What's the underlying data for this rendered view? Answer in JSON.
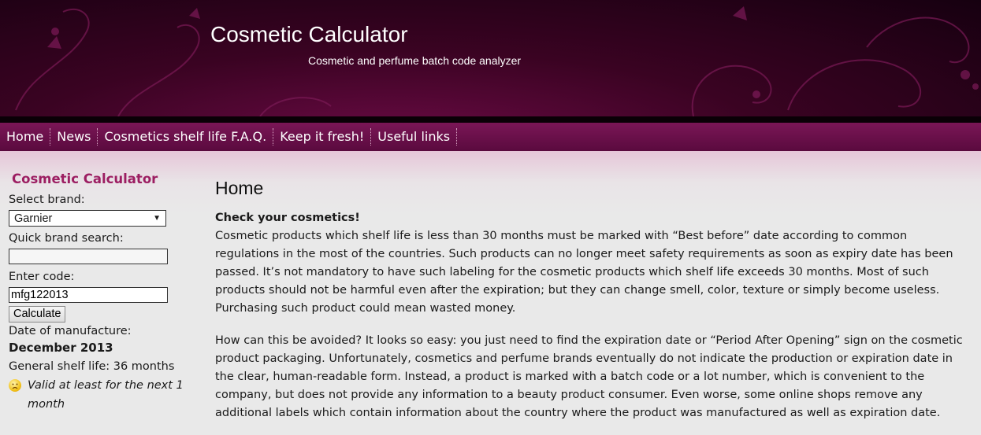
{
  "header": {
    "title": "Cosmetic Calculator",
    "subtitle": "Cosmetic and perfume batch code analyzer"
  },
  "nav": {
    "items": [
      "Home",
      "News",
      "Cosmetics shelf life F.A.Q.",
      "Keep it fresh!",
      "Useful links"
    ]
  },
  "sidebar": {
    "title": "Cosmetic Calculator",
    "brand_label": "Select brand:",
    "brand_value": "Garnier",
    "search_label": "Quick brand search:",
    "search_value": "",
    "code_label": "Enter code:",
    "code_value": "mfg122013",
    "calculate_label": "Calculate",
    "manufacture_label": "Date of manufacture:",
    "manufacture_value": "December 2013",
    "shelf_life": "General shelf life: 36 months",
    "validity": "Valid at least for the next 1 month",
    "validity_icon": "sad-face-icon"
  },
  "main": {
    "title": "Home",
    "lead": "Check your cosmetics!",
    "paragraph1": "Cosmetic products which shelf life is less than 30 months must be marked with “Best before” date according to common regulations in the most of the countries. Such products can no longer meet safety requirements as soon as expiry date has been passed. It’s not mandatory to have such labeling for the cosmetic products which shelf life exceeds 30 months. Most of such products should not be harmful even after the expiration; but they can change smell, color, texture or simply become useless. Purchasing such product could mean wasted money.",
    "paragraph2": "How can this be avoided? It looks so easy: you just need to find the expiration date or “Period After Opening” sign on the cosmetic product packaging. Unfortunately, cosmetics and perfume brands eventually do not indicate the production or expiration date in the clear, human-readable form. Instead, a product is marked with a batch code or a lot number, which is convenient to the company, but does not provide any information to a beauty product consumer. Even worse, some online shops remove any additional labels which contain information about the country where the product was manufactured as well as expiration date."
  },
  "colors": {
    "header_dark": "#160010",
    "nav": "#6a1049",
    "accent": "#9c1e62"
  }
}
